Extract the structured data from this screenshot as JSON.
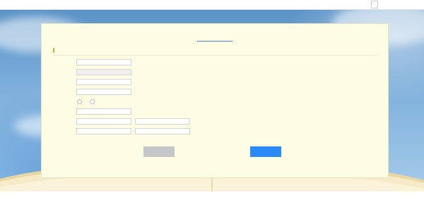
{
  "header": {
    "site_title": "",
    "back_home_label": ""
  },
  "panel": {
    "title": "",
    "title_required": "",
    "section_title": ""
  },
  "form": {
    "rows": [
      {
        "label": "",
        "value": "",
        "hint": ""
      },
      {
        "label": "",
        "value": "",
        "hint": ""
      },
      {
        "label": "",
        "value": "",
        "hint": ""
      },
      {
        "label": "",
        "value": ""
      },
      {
        "label": "",
        "value": "",
        "options": [
          "",
          ""
        ]
      },
      {
        "label": "",
        "value": ""
      },
      {
        "label": "",
        "value": "",
        "value2": ""
      },
      {
        "label": "",
        "value": "",
        "value2": ""
      }
    ]
  },
  "buttons": {
    "prev_label": "",
    "next_label": ""
  },
  "footer": {
    "copyright": ""
  },
  "background": {
    "watermark": "",
    "windows_note": ""
  },
  "colors": {
    "panel_bg": "#fdfde3",
    "required": "#e23a3a",
    "primary_button": "#2a8af6",
    "disabled_button": "#c4c6c8",
    "section_accent": "#f1a02a",
    "title_underline": "#4a7fd0"
  }
}
